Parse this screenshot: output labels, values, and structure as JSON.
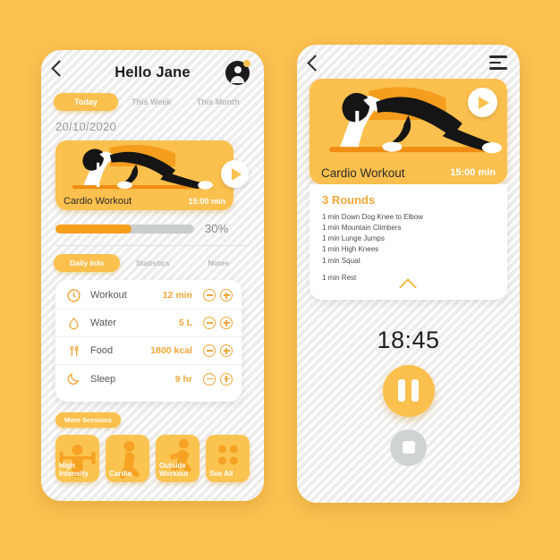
{
  "theme": {
    "background": "#fcc14f",
    "accent": "#fbc04e",
    "accent_dark": "#f0a63a",
    "progress_fill": "#f79f1a",
    "card_white": "#ffffff",
    "muted_text": "#b9b9b9",
    "stop_grey": "#cfd3d4"
  },
  "left_screen": {
    "back_icon": "chevron-left-icon",
    "title": "Hello Jane",
    "avatar_icon": "user-avatar-icon",
    "period_tabs": [
      {
        "label": "Today",
        "active": true
      },
      {
        "label": "This Week",
        "active": false
      },
      {
        "label": "This Month",
        "active": false
      }
    ],
    "date": "20/10/2020",
    "workout_card": {
      "title": "Cardio Workout",
      "duration": "15:00 min",
      "play_icon": "play-icon"
    },
    "progress": {
      "percent_label": "30%",
      "value": 30,
      "bar_fill_ratio": 55
    },
    "info_tabs": [
      {
        "label": "Daily Info",
        "active": true
      },
      {
        "label": "Statistics",
        "active": false
      },
      {
        "label": "Notes",
        "active": false
      }
    ],
    "stats": [
      {
        "icon": "clock-icon",
        "name": "Workout",
        "value": "12 min"
      },
      {
        "icon": "water-drop-icon",
        "name": "Water",
        "value": "5 L"
      },
      {
        "icon": "cutlery-icon",
        "name": "Food",
        "value": "1800 kcal"
      },
      {
        "icon": "moon-icon",
        "name": "Sleep",
        "value": "9 hr"
      }
    ],
    "stat_minus_icon": "minus-circle-icon",
    "stat_plus_icon": "plus-circle-icon",
    "more_sessions_label": "More Sessions",
    "sessions": [
      {
        "label": "High Intensity",
        "icon": "dumbbell-person-icon"
      },
      {
        "label": "Cardio",
        "icon": "lunge-person-icon"
      },
      {
        "label": "Outside Workout",
        "icon": "running-person-icon"
      },
      {
        "label": "See All",
        "icon": "grid-dots-icon"
      }
    ]
  },
  "right_screen": {
    "back_icon": "chevron-left-icon",
    "menu_icon": "hamburger-menu-icon",
    "workout_card": {
      "title": "Cardio Workout",
      "duration": "15:00 min",
      "play_icon": "play-icon"
    },
    "rounds_title": "3 Rounds",
    "exercises": [
      "1 min Down Dog Knee to Elbow",
      "1 min Mountain Climbers",
      "1 min Lunge Jumps",
      "1 min High Knees",
      "1 min Squat"
    ],
    "rest": "1 min Rest",
    "collapse_icon": "chevron-up-icon",
    "timer": "18:45",
    "pause_icon": "pause-icon",
    "stop_icon": "stop-icon"
  }
}
